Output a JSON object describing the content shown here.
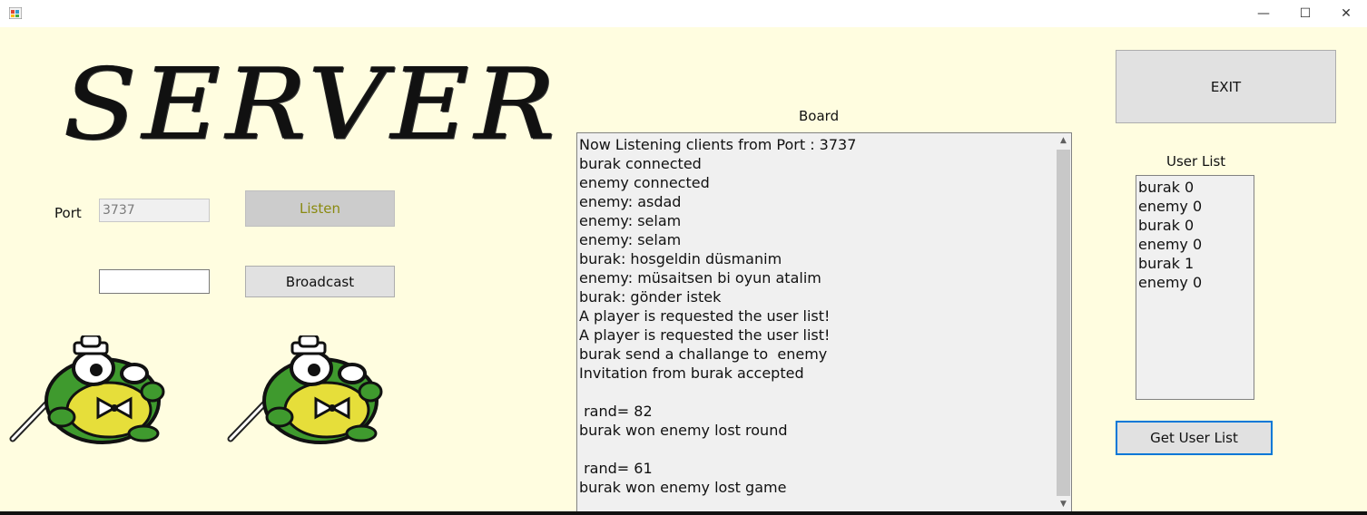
{
  "window": {
    "minimize_glyph": "—",
    "maximize_glyph": "☐",
    "close_glyph": "✕"
  },
  "title": "SERVER",
  "port": {
    "label": "Port",
    "value": "3737"
  },
  "listen_button": "Listen",
  "broadcast": {
    "input_value": "",
    "button": "Broadcast"
  },
  "board": {
    "label": "Board",
    "lines": [
      "Now Listening clients from Port : 3737",
      "burak connected",
      "enemy connected",
      "enemy: asdad",
      "enemy: selam",
      "enemy: selam",
      "burak: hosgeldin düsmanim",
      "enemy: müsaitsen bi oyun atalim",
      "burak: gönder istek",
      "A player is requested the user list!",
      "A player is requested the user list!",
      "burak send a challange to  enemy",
      "Invitation from burak accepted",
      "",
      " rand= 82",
      "burak won enemy lost round",
      "",
      " rand= 61",
      "burak won enemy lost game"
    ]
  },
  "exit_button": "EXIT",
  "user_list": {
    "label": "User List",
    "items": [
      "burak 0",
      "enemy 0",
      "burak 0",
      "enemy 0",
      "burak 1",
      "enemy 0"
    ]
  },
  "get_user_list_button": "Get User List",
  "icons": [
    "app-icon",
    "frog-mascot-icon",
    "scroll-up-icon",
    "scroll-down-icon"
  ],
  "colors": {
    "background": "#fffde0",
    "disabled_text": "#8a8a10",
    "focus_border": "#0078d7"
  }
}
